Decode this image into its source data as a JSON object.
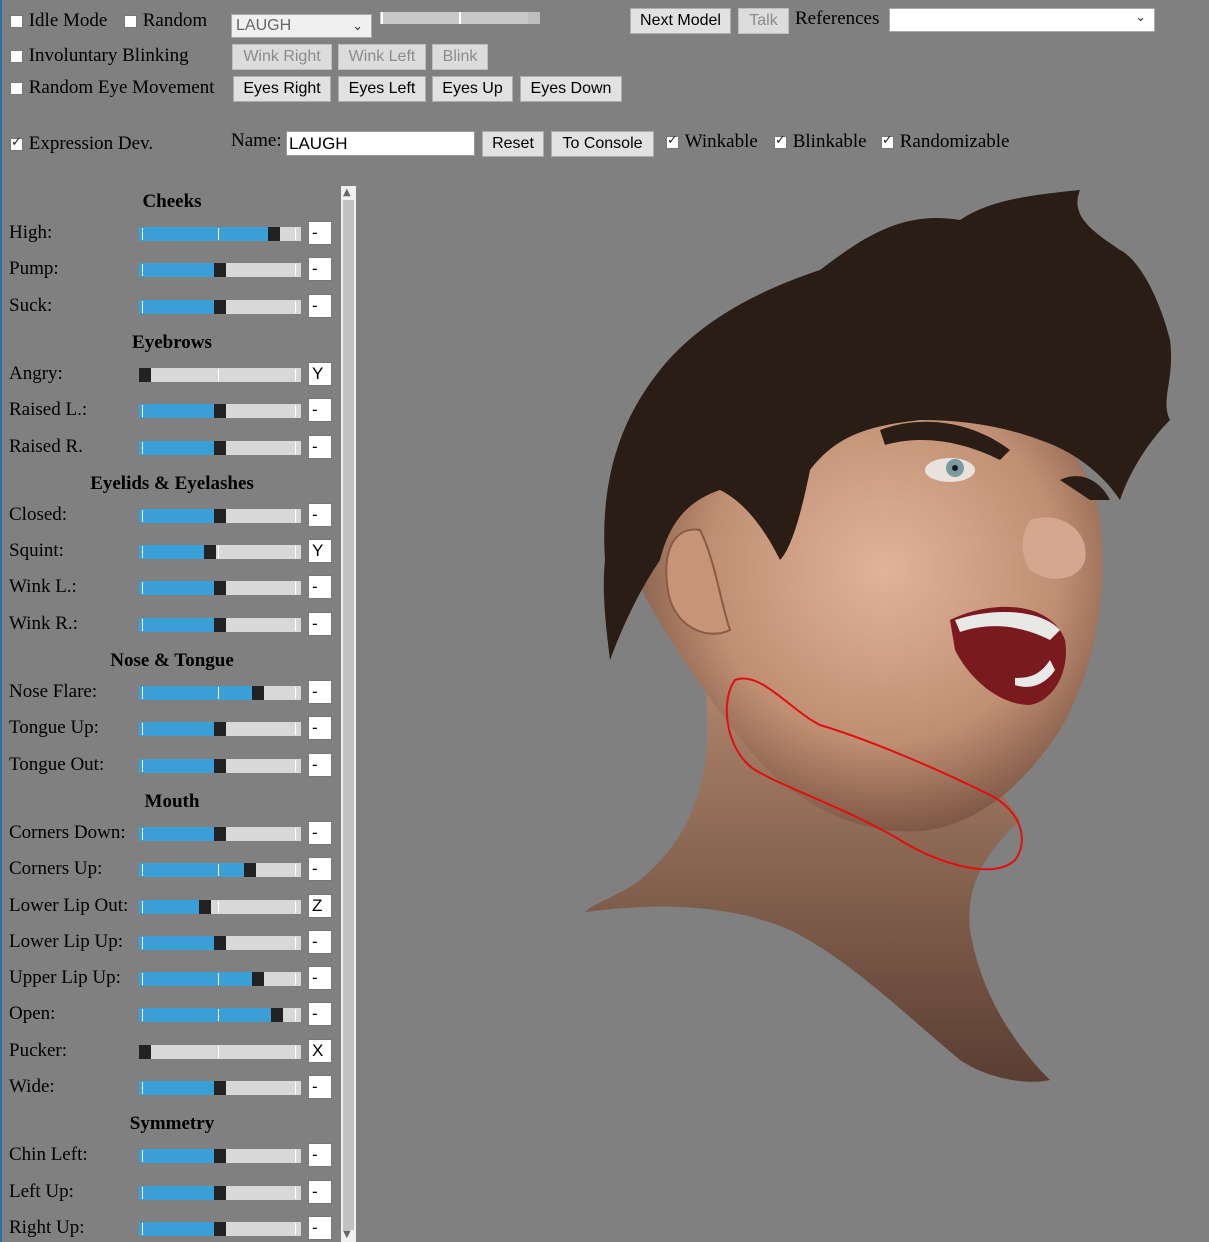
{
  "controls": {
    "idle_mode": {
      "label": "Idle Mode",
      "checked": false
    },
    "random": {
      "label": "Random",
      "checked": false
    },
    "expression_select": {
      "value": "LAUGH"
    },
    "next_model": "Next Model",
    "talk": "Talk",
    "references_label": "References",
    "references_select": {
      "value": ""
    },
    "involuntary_blinking": {
      "label": "Involuntary Blinking",
      "checked": false
    },
    "wink_right": "Wink Right",
    "wink_left": "Wink Left",
    "blink": "Blink",
    "random_eye_movement": {
      "label": "Random Eye Movement",
      "checked": false
    },
    "eyes_right": "Eyes Right",
    "eyes_left": "Eyes Left",
    "eyes_up": "Eyes Up",
    "eyes_down": "Eyes Down",
    "expression_dev": {
      "label": "Expression Dev.",
      "checked": true
    },
    "name_label": "Name:",
    "name_value": "LAUGH",
    "reset": "Reset",
    "to_console": "To Console",
    "winkable": {
      "label": "Winkable",
      "checked": true
    },
    "blinkable": {
      "label": "Blinkable",
      "checked": true
    },
    "randomizable": {
      "label": "Randomizable",
      "checked": true
    }
  },
  "panel": {
    "sections": [
      {
        "title": "Cheeks",
        "rows": [
          {
            "label": "High:",
            "value": 0.86,
            "key": "-"
          },
          {
            "label": "Pump:",
            "value": 0.5,
            "key": "-"
          },
          {
            "label": "Suck:",
            "value": 0.5,
            "key": "-"
          }
        ]
      },
      {
        "title": "Eyebrows",
        "rows": [
          {
            "label": "Angry:",
            "value": 0.0,
            "key": "Y"
          },
          {
            "label": "Raised L.:",
            "value": 0.5,
            "key": "-"
          },
          {
            "label": "Raised R.",
            "value": 0.5,
            "key": "-"
          }
        ]
      },
      {
        "title": "Eyelids & Eyelashes",
        "rows": [
          {
            "label": "Closed:",
            "value": 0.5,
            "key": "-"
          },
          {
            "label": "Squint:",
            "value": 0.43,
            "key": "Y"
          },
          {
            "label": "Wink L.:",
            "value": 0.5,
            "key": "-"
          },
          {
            "label": "Wink R.:",
            "value": 0.5,
            "key": "-"
          }
        ]
      },
      {
        "title": "Nose & Tongue",
        "rows": [
          {
            "label": "Nose Flare:",
            "value": 0.75,
            "key": "-"
          },
          {
            "label": "Tongue Up:",
            "value": 0.5,
            "key": "-"
          },
          {
            "label": "Tongue Out:",
            "value": 0.5,
            "key": "-"
          }
        ]
      },
      {
        "title": "Mouth",
        "rows": [
          {
            "label": "Corners Down:",
            "value": 0.5,
            "key": "-"
          },
          {
            "label": "Corners Up:",
            "value": 0.7,
            "key": "-"
          },
          {
            "label": "Lower Lip Out:",
            "value": 0.4,
            "key": "Z"
          },
          {
            "label": "Lower Lip Up:",
            "value": 0.5,
            "key": "-"
          },
          {
            "label": "Upper Lip Up:",
            "value": 0.75,
            "key": "-"
          },
          {
            "label": "Open:",
            "value": 0.88,
            "key": "-"
          },
          {
            "label": "Pucker:",
            "value": 0.0,
            "key": "X"
          },
          {
            "label": "Wide:",
            "value": 0.5,
            "key": "-"
          }
        ]
      },
      {
        "title": "Symmetry",
        "rows": [
          {
            "label": "Chin Left:",
            "value": 0.5,
            "key": "-"
          },
          {
            "label": "Left Up:",
            "value": 0.5,
            "key": "-"
          },
          {
            "label": "Right Up:",
            "value": 0.5,
            "key": "-"
          }
        ]
      }
    ]
  },
  "viewport": {
    "background": "#808080",
    "annotation_color": "#e01010"
  }
}
